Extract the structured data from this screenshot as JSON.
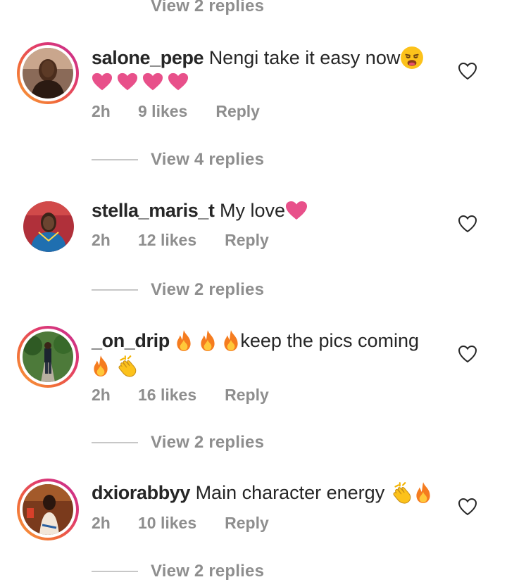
{
  "top_view_replies": "View 2 replies",
  "comments": [
    {
      "username": "salone_pepe",
      "text": "Nengi take it easy now",
      "time": "2h",
      "likes": "9 likes",
      "reply": "Reply",
      "view_replies": "View 4 replies"
    },
    {
      "username": "stella_maris_t",
      "text": "My love",
      "time": "2h",
      "likes": "12 likes",
      "reply": "Reply",
      "view_replies": "View 2 replies"
    },
    {
      "username": "_on_drip",
      "text": "keep the pics coming",
      "time": "2h",
      "likes": "16 likes",
      "reply": "Reply",
      "view_replies": "View 2 replies"
    },
    {
      "username": "dxiorabbyy",
      "text": "Main character energy",
      "time": "2h",
      "likes": "10 likes",
      "reply": "Reply",
      "view_replies": "View 2 replies"
    }
  ],
  "colors": {
    "heart_emoji": "#e8508a",
    "meta_grey": "#8e8e8e",
    "story_ring_start": "#f9a23b",
    "story_ring_end": "#c42f93"
  },
  "icons": [
    "heart-outline-icon",
    "pink-heart-emoji",
    "fire-emoji",
    "clap-emoji",
    "weary-face-emoji"
  ]
}
